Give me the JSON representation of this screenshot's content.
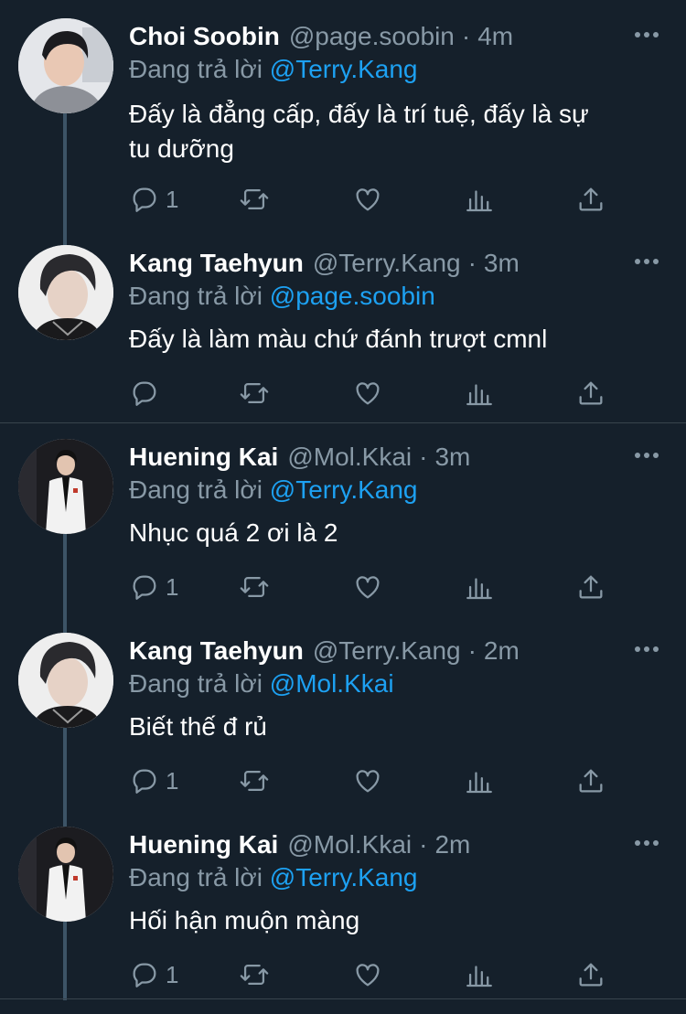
{
  "reply_prefix": "Đang trả lời",
  "tweets": [
    {
      "name": "Choi Soobin",
      "handle": "@page.soobin",
      "time": "4m",
      "reply_to": "@Terry.Kang",
      "text_lines": [
        "Đấy là đẳng cấp, đấy là trí tuệ, đấy là sự",
        "tu dưỡng"
      ],
      "reply_count": "1"
    },
    {
      "name": "Kang Taehyun",
      "handle": "@Terry.Kang",
      "time": "3m",
      "reply_to": "@page.soobin",
      "text_lines": [
        "Đấy là làm màu chứ đánh trượt cmnl"
      ],
      "reply_count": ""
    },
    {
      "name": "Huening Kai",
      "handle": "@Mol.Kkai",
      "time": "3m",
      "reply_to": "@Terry.Kang",
      "text_lines": [
        "Nhục quá 2 ơi là 2"
      ],
      "reply_count": "1"
    },
    {
      "name": "Kang Taehyun",
      "handle": "@Terry.Kang",
      "time": "2m",
      "reply_to": "@Mol.Kkai",
      "text_lines": [
        "Biết thế đ rủ"
      ],
      "reply_count": "1"
    },
    {
      "name": "Huening Kai",
      "handle": "@Mol.Kkai",
      "time": "2m",
      "reply_to": "@Terry.Kang",
      "text_lines": [
        "Hối hận muộn màng"
      ],
      "reply_count": "1"
    }
  ]
}
